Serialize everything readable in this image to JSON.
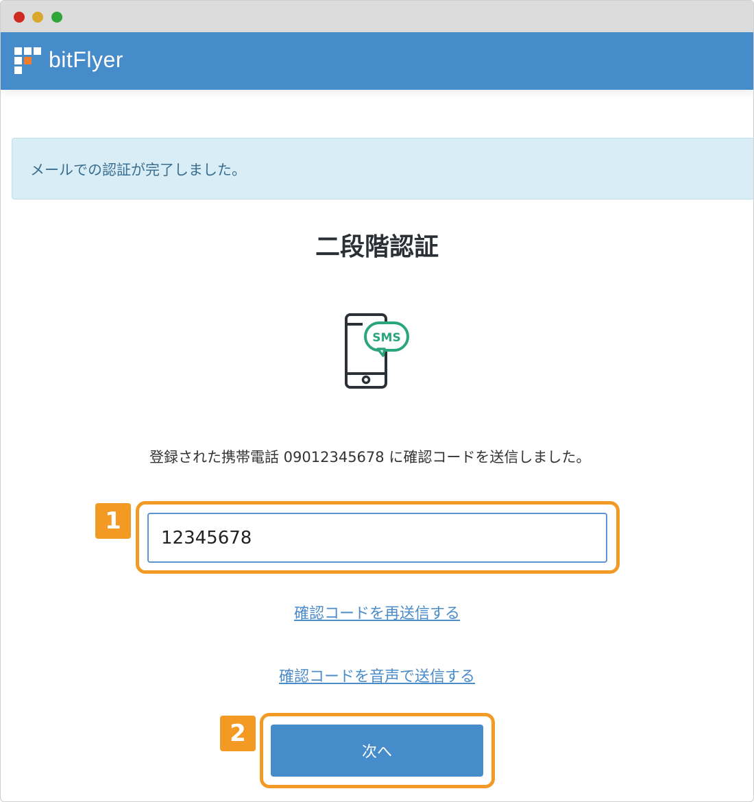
{
  "window": {
    "controls": [
      "close",
      "minimize",
      "maximize"
    ]
  },
  "header": {
    "brand": "bitFlyer",
    "logo_icon": "bitflyer-logo-icon",
    "background": "#468bca"
  },
  "alert": {
    "text": "メールでの認証が完了しました。",
    "background": "#d9edf7"
  },
  "page_title": "二段階認証",
  "sms_icon": {
    "name": "smartphone-sms-icon",
    "bubble_text": "SMS",
    "bubble_color": "#2aa67a"
  },
  "message": "登録された携帯電話 09012345678 に確認コードを送信しました。",
  "code_input": {
    "value": "12345678"
  },
  "links": {
    "resend": "確認コードを再送信する",
    "voice": "確認コードを音声で送信する"
  },
  "next_button": {
    "label": "次へ"
  },
  "annotations": [
    {
      "number": "1"
    },
    {
      "number": "2"
    }
  ],
  "colors": {
    "accent": "#468bca",
    "highlight": "#f39a25",
    "link": "#4a8bc9"
  }
}
